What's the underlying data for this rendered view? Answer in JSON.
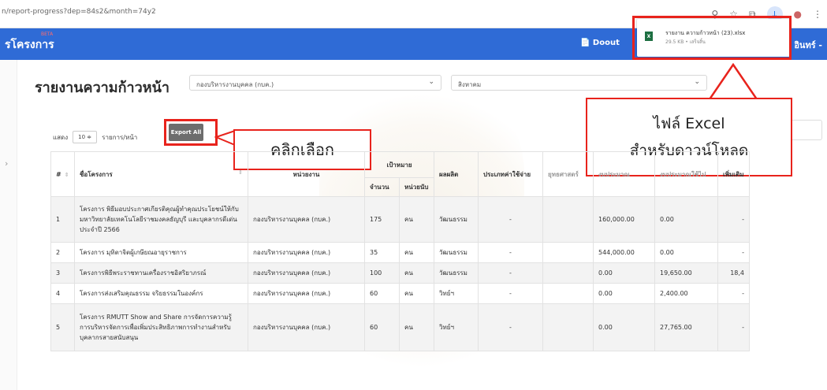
{
  "browser": {
    "url": "n/report-progress?dep=84s2&month=74y2",
    "star_icon": "star-icon",
    "zoom_icon": "zoom-icon",
    "extension_icon": "puzzle-icon",
    "download_icon": "download-icon",
    "profile_icon": "profile-icon",
    "menu_icon": "kebab-icon"
  },
  "download": {
    "filename": "รายงาน ความก้าวหน้า (23).xlsx",
    "meta": "29.5 KB • เสร็จสิ้น",
    "file_icon_text": "X"
  },
  "appbar": {
    "brand": "รโครงการ",
    "beta": "BETA",
    "menu_label": "📄 Doout",
    "user_label": "อินทร์ -"
  },
  "page": {
    "title": "รายงานความก้าวหน้า",
    "dept_select": "กองบริหารงานบุคคล (กบค.)",
    "month_select": "สิงหาคม",
    "show_label": "แสดง",
    "page_size": "10",
    "page_size_caret": "≑",
    "records_label": "รายการ/หน้า",
    "export_label": "Export All"
  },
  "annotations": {
    "callout_click": "คลิกเลือก",
    "callout_excel_line1": "ไฟล์ Excel",
    "callout_excel_line2": "สำหรับดาวน์โหลด"
  },
  "table": {
    "headers": {
      "index": "#",
      "name": "ชื่อโครงการ",
      "unit": "หน่วยงาน",
      "target_group": "เป้าหมาย",
      "amount": "จำนวน",
      "count_unit": "หน่วยนับ",
      "output": "ผลผลิต",
      "expense_type": "ประเภทค่าใช้จ่าย",
      "h9": "ยุทธศาสตร์",
      "h10": "งบประมาณ",
      "h11": "งบประมาณใช้ไป",
      "h12": "เพิ่มเติม"
    },
    "rows": [
      {
        "i": "1",
        "name": "โครงการ พิธีมอบประกาศเกียรติคุณผู้ทำคุณประโยชน์ให้กับมหาวิทยาลัยเทคโนโลยีราชมงคลธัญบุรี และบุคลากรดีเด่น ประจำปี 2566",
        "unit": "กองบริหารงานบุคคล (กบค.)",
        "amount": "175",
        "count_unit": "คน",
        "output": "วัฒนธรรม",
        "type": "-",
        "c9": "",
        "c10": "160,000.00",
        "c11": "0.00",
        "c12": "-"
      },
      {
        "i": "2",
        "name": "โครงการ มุทิตาจิตผู้เกษียณอายุราชการ",
        "unit": "กองบริหารงานบุคคล (กบค.)",
        "amount": "35",
        "count_unit": "คน",
        "output": "วัฒนธรรม",
        "type": "-",
        "c9": "",
        "c10": "544,000.00",
        "c11": "0.00",
        "c12": "-"
      },
      {
        "i": "3",
        "name": "โครงการพิธีพระราชทานเครื่องราชอิสริยาภรณ์",
        "unit": "กองบริหารงานบุคคล (กบค.)",
        "amount": "100",
        "count_unit": "คน",
        "output": "วัฒนธรรม",
        "type": "-",
        "c9": "",
        "c10": "0.00",
        "c11": "19,650.00",
        "c12": "18,4"
      },
      {
        "i": "4",
        "name": "โครงการส่งเสริมคุณธรรม จริยธรรมในองค์กร",
        "unit": "กองบริหารงานบุคคล (กบค.)",
        "amount": "60",
        "count_unit": "คน",
        "output": "วิทย์ฯ",
        "type": "-",
        "c9": "",
        "c10": "0.00",
        "c11": "2,400.00",
        "c12": "-"
      },
      {
        "i": "5",
        "name": "โครงการ RMUTT Show and Share การจัดการความรู้ การบริหารจัดการเพื่อเพิ่มประสิทธิภาพการทำงานสำหรับบุคลากรสายสนับสนุน",
        "unit": "กองบริหารงานบุคคล (กบค.)",
        "amount": "60",
        "count_unit": "คน",
        "output": "วิทย์ฯ",
        "type": "-",
        "c9": "",
        "c10": "0.00",
        "c11": "27,765.00",
        "c12": "-"
      }
    ]
  }
}
